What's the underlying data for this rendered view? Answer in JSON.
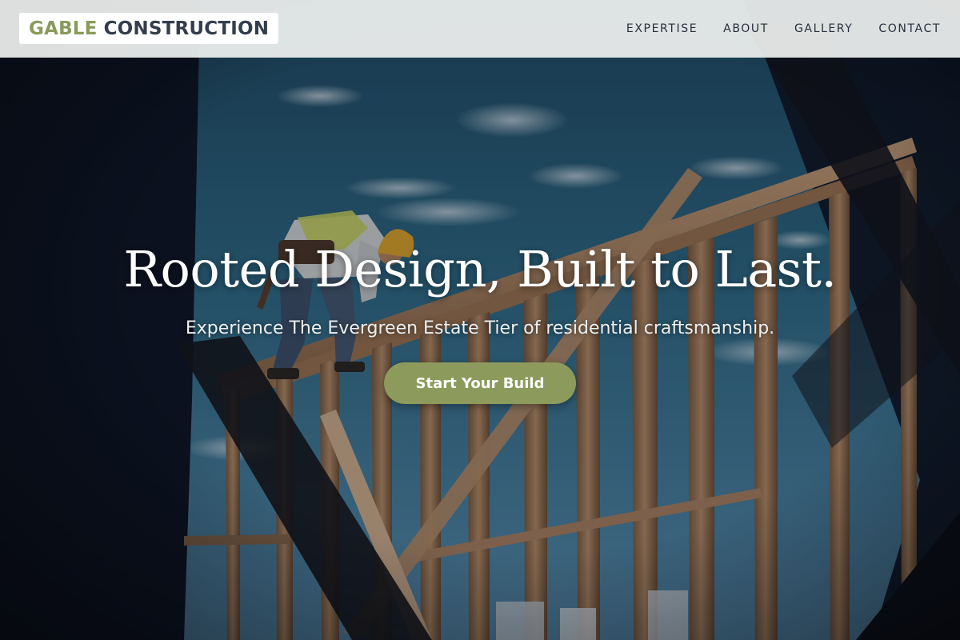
{
  "brand": {
    "name_accent": "GABLE",
    "name_rest": "CONSTRUCTION",
    "accent_color": "#8a9a5b",
    "dark_color": "#333d4d"
  },
  "nav": {
    "items": [
      {
        "label": "EXPERTISE"
      },
      {
        "label": "ABOUT"
      },
      {
        "label": "GALLERY"
      },
      {
        "label": "CONTACT"
      }
    ]
  },
  "hero": {
    "title": "Rooted Design, Built to Last.",
    "subtitle": "Experience The Evergreen Estate Tier of residential craftsmanship.",
    "cta_label": "Start Your Build",
    "cta_color": "#8c9a5c",
    "image_subject": "construction worker in hard hat on wooden house framing against blue sky"
  }
}
